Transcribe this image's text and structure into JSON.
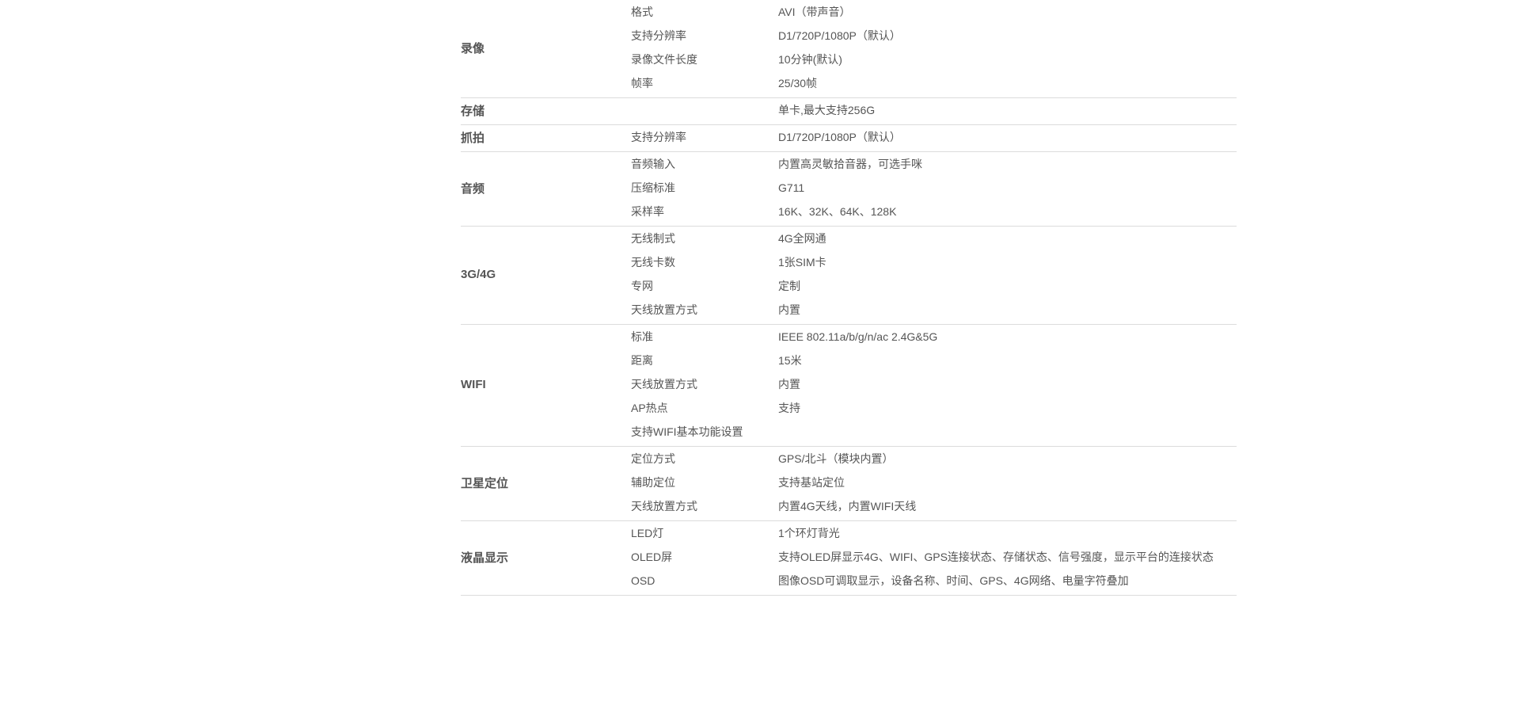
{
  "spec_table": {
    "sections": [
      {
        "label": "录像",
        "rows": [
          {
            "key": "格式",
            "value": "AVI（带声音）"
          },
          {
            "key": "支持分辨率",
            "value": "D1/720P/1080P（默认）"
          },
          {
            "key": "录像文件长度",
            "value": "10分钟(默认)"
          },
          {
            "key": "帧率",
            "value": "25/30帧"
          }
        ]
      },
      {
        "label": "存储",
        "rows": [
          {
            "key": "",
            "value": "单卡,最大支持256G"
          }
        ]
      },
      {
        "label": "抓拍",
        "rows": [
          {
            "key": "支持分辨率",
            "value": "D1/720P/1080P（默认）"
          }
        ]
      },
      {
        "label": "音频",
        "rows": [
          {
            "key": "音频输入",
            "value": "内置高灵敏拾音器，可选手咪"
          },
          {
            "key": "压缩标准",
            "value": "G711"
          },
          {
            "key": "采样率",
            "value": "16K、32K、64K、128K"
          }
        ]
      },
      {
        "label": "3G/4G",
        "rows": [
          {
            "key": "无线制式",
            "value": "4G全网通"
          },
          {
            "key": "无线卡数",
            "value": "1张SIM卡"
          },
          {
            "key": "专网",
            "value": "定制"
          },
          {
            "key": "天线放置方式",
            "value": "内置"
          }
        ]
      },
      {
        "label": "WIFI",
        "rows": [
          {
            "key": "标准",
            "value": "IEEE 802.11a/b/g/n/ac  2.4G&5G"
          },
          {
            "key": "距离",
            "value": "15米"
          },
          {
            "key": "天线放置方式",
            "value": "内置"
          },
          {
            "key": "AP热点",
            "value": "支持"
          },
          {
            "key": "支持WIFI基本功能设置",
            "value": ""
          }
        ]
      },
      {
        "label": "卫星定位",
        "rows": [
          {
            "key": "定位方式",
            "value": "GPS/北斗（模块内置）"
          },
          {
            "key": "辅助定位",
            "value": "支持基站定位"
          },
          {
            "key": "天线放置方式",
            "value": "内置4G天线，内置WIFI天线"
          }
        ]
      },
      {
        "label": "液晶显示",
        "rows": [
          {
            "key": "LED灯",
            "value": "1个环灯背光"
          },
          {
            "key": "OLED屏",
            "value": "支持OLED屏显示4G、WIFI、GPS连接状态、存储状态、信号强度，显示平台的连接状态"
          },
          {
            "key": "OSD",
            "value": "图像OSD可调取显示，设备名称、时间、GPS、4G网络、电量字符叠加"
          }
        ]
      }
    ]
  }
}
